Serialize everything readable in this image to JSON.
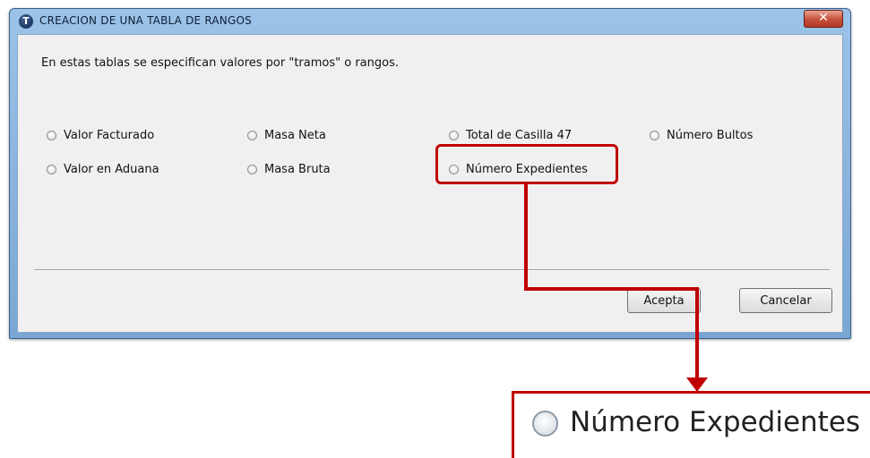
{
  "window": {
    "title": "CREACION DE UNA TABLA DE RANGOS",
    "close_label": "✕"
  },
  "description": "En estas tablas se especifican valores por \"tramos\" o rangos.",
  "options": [
    {
      "label": "Valor Facturado",
      "selected": false
    },
    {
      "label": "Masa Neta",
      "selected": false
    },
    {
      "label": "Total de Casilla 47",
      "selected": false
    },
    {
      "label": "Número Bultos",
      "selected": false
    },
    {
      "label": "Valor en Aduana",
      "selected": false
    },
    {
      "label": "Masa Bruta",
      "selected": false
    },
    {
      "label": "Número Expedientes",
      "selected": false
    }
  ],
  "buttons": {
    "accept_label": "Acepta",
    "cancel_label": "Cancelar"
  },
  "zoom": {
    "label": "Número Expedientes"
  },
  "colors": {
    "annotation": "#c00000",
    "titlebar": "#8fb8e2"
  }
}
